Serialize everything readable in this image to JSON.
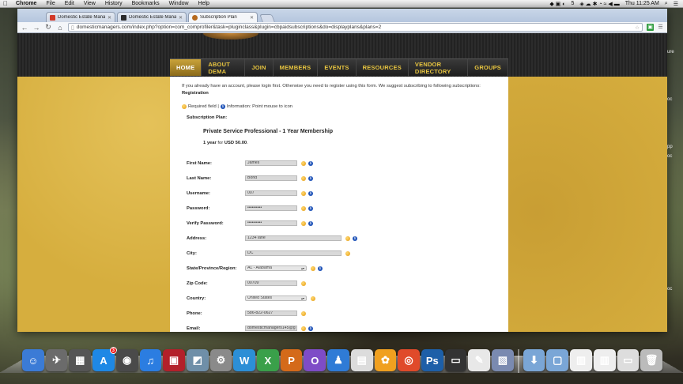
{
  "menubar": {
    "app": "Chrome",
    "items": [
      "File",
      "Edit",
      "View",
      "History",
      "Bookmarks",
      "Window",
      "Help"
    ],
    "status": {
      "badge_count": "5",
      "clock": "Thu 11:25 AM"
    }
  },
  "browser": {
    "tabs": [
      {
        "label": "Domestic Estate Managers A",
        "favicon": "gmail-icon",
        "color": "#d23a2a"
      },
      {
        "label": "Domestic Estate Managers A",
        "favicon": "site-icon",
        "color": "#2a2a2a"
      },
      {
        "label": "Subscription Plan",
        "favicon": "dema-icon",
        "color": "#b66a1e",
        "active": true
      }
    ],
    "url": "domesticmanagers.com/index.php?option=com_comprofiler&task=pluginclass&plugin=cbpaidsubscriptions&do=displayplans&plans=2"
  },
  "site": {
    "nav": [
      "HOME",
      "ABOUT DEMA",
      "JOIN",
      "MEMBERS",
      "EVENTS",
      "RESOURCES",
      "VENDOR DIRECTORY",
      "GROUPS"
    ],
    "intro": "If you already have an account, please login first. Otherwise you need to register using this form. We suggest subscribing to following subscriptions:",
    "registration_title": "Registration",
    "legend_required": "Required field |",
    "legend_info": "Information: Point mouse to icon",
    "subscription_label": "Subscription Plan:",
    "plan_name": "Private Service Professional - 1 Year Membership",
    "plan_period": "1 year",
    "plan_for": "for",
    "plan_price": "USD 50.00",
    "plan_end": ".",
    "fields": [
      {
        "label": "First Name:",
        "value": "James",
        "width": 66,
        "required": true,
        "info": true
      },
      {
        "label": "Last Name:",
        "value": "Bond",
        "width": 66,
        "required": true,
        "info": true
      },
      {
        "label": "Username:",
        "value": "007",
        "width": 66,
        "required": true,
        "info": true
      },
      {
        "label": "Password:",
        "value": "••••••••••",
        "width": 66,
        "required": true,
        "info": true
      },
      {
        "label": "Verify Password:",
        "value": "••••••••••",
        "width": 66,
        "required": true,
        "info": true
      },
      {
        "label": "Address:",
        "value": "1234 lane",
        "width": 122,
        "required": true,
        "info": true
      },
      {
        "label": "City:",
        "value": "DC",
        "width": 122,
        "required": true,
        "info": false
      },
      {
        "label": "State/Province/Region:",
        "value": "AL - Alabama",
        "width": 78,
        "required": true,
        "info": true,
        "select": true
      },
      {
        "label": "Zip Code:",
        "value": "00709",
        "width": 66,
        "required": true,
        "info": false
      },
      {
        "label": "Country:",
        "value": "United States",
        "width": 78,
        "required": true,
        "info": false,
        "select": true
      },
      {
        "label": "Phone:",
        "value": "586-822-0627",
        "width": 66,
        "required": true,
        "info": false
      },
      {
        "label": "Email:",
        "value": "domesticmanagers145@g",
        "width": 66,
        "required": true,
        "info": true
      }
    ]
  },
  "right_sliver": [
    "ure",
    "",
    "",
    "",
    "",
    "oc",
    "",
    "",
    "",
    "",
    "pp",
    "oc",
    "",
    "",
    "",
    "",
    "",
    "",
    "",
    "",
    "",
    "",
    "",
    "",
    "",
    "oc"
  ],
  "dock": [
    {
      "name": "finder-icon",
      "color": "#3b7bd6",
      "glyph": "☺"
    },
    {
      "name": "launchpad-icon",
      "color": "#6b6b6b",
      "glyph": "✈"
    },
    {
      "name": "dashboard-icon",
      "color": "#555",
      "glyph": "▦"
    },
    {
      "name": "app-store-icon",
      "color": "#1e88e5",
      "glyph": "A",
      "badge": "3"
    },
    {
      "name": "facetime-icon",
      "color": "#4a4a4a",
      "glyph": "◉"
    },
    {
      "name": "itunes-icon",
      "color": "#2b7de1",
      "glyph": "♫"
    },
    {
      "name": "photo-booth-icon",
      "color": "#b3202a",
      "glyph": "▣"
    },
    {
      "name": "iphoto-icon",
      "color": "#6f8fa8",
      "glyph": "◩"
    },
    {
      "name": "system-preferences-icon",
      "color": "#8a8a8a",
      "glyph": "⚙"
    },
    {
      "name": "word-icon",
      "color": "#2c8fd6",
      "glyph": "W"
    },
    {
      "name": "excel-icon",
      "color": "#3aa04a",
      "glyph": "X"
    },
    {
      "name": "powerpoint-icon",
      "color": "#d46a1a",
      "glyph": "P"
    },
    {
      "name": "outlook-icon",
      "color": "#7e4cc7",
      "glyph": "O"
    },
    {
      "name": "messenger-icon",
      "color": "#2f7bd6",
      "glyph": "♟"
    },
    {
      "name": "spreadsheet-icon",
      "color": "#dcdcdc",
      "glyph": "▤"
    },
    {
      "name": "flower-icon",
      "color": "#f0a020",
      "glyph": "✿"
    },
    {
      "name": "chrome-icon",
      "color": "#e04a2a",
      "glyph": "◎"
    },
    {
      "name": "photoshop-icon",
      "color": "#1d5fa8",
      "glyph": "Ps"
    },
    {
      "name": "monitor-icon",
      "color": "#333",
      "glyph": "▭"
    },
    {
      "name": "acrobat-icon",
      "color": "#e8e8e8",
      "glyph": "✎"
    },
    {
      "name": "preview-icon",
      "color": "#7a8ab0",
      "glyph": "▧"
    },
    {
      "name": "downloads-folder-icon",
      "color": "#7aa6d6",
      "glyph": "⬇"
    },
    {
      "name": "documents-folder-icon",
      "color": "#7aa6d6",
      "glyph": "▢"
    },
    {
      "name": "document-stack-icon",
      "color": "#eee",
      "glyph": "▥"
    },
    {
      "name": "document-stack-2-icon",
      "color": "#eee",
      "glyph": "▥"
    },
    {
      "name": "window-stack-icon",
      "color": "#ddd",
      "glyph": "▭"
    },
    {
      "name": "trash-icon",
      "color": "#bbb",
      "glyph": "🗑"
    }
  ]
}
